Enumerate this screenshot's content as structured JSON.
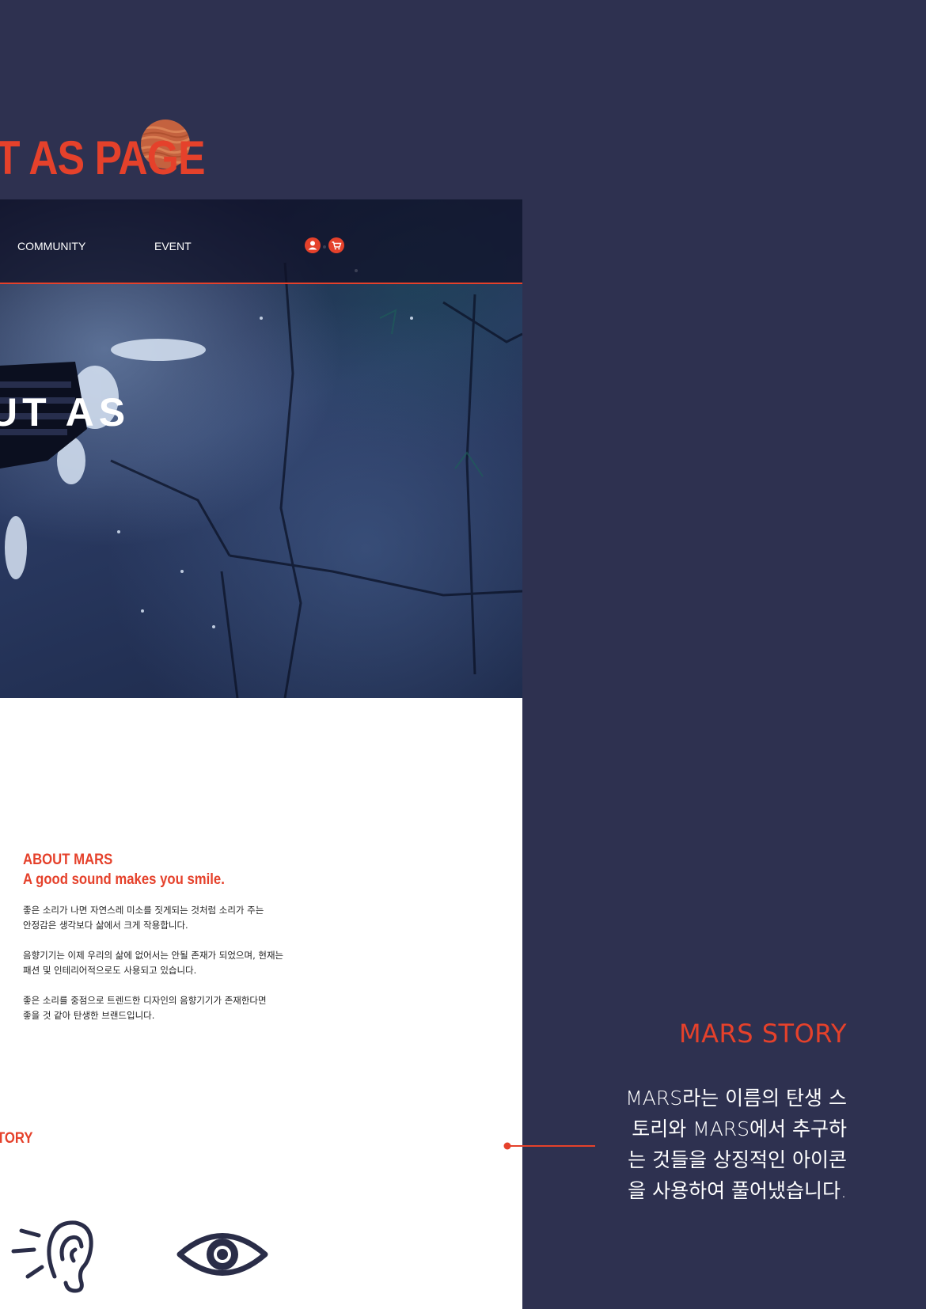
{
  "page": {
    "title": "T AS PAGE"
  },
  "nav": {
    "items": [
      {
        "label": "COMMUNITY"
      },
      {
        "label": "EVENT"
      }
    ],
    "icons": [
      "user-icon",
      "cart-icon"
    ]
  },
  "hero": {
    "text": "UT AS"
  },
  "about": {
    "heading": "ABOUT MARS",
    "subheading": "A good sound makes you smile.",
    "paragraphs": [
      {
        "line1": "좋은 소리가 나면 자연스레 미소를 짓게되는 것처럼 소리가 주는",
        "line2": "안정감은 생각보다 삶에서 크게 작용합니다."
      },
      {
        "line1": "음향기기는 이제 우리의 삶에 없어서는 안될 존재가 되었으며, 현재는",
        "line2": "패션 및 인테리어적으로도 사용되고 있습니다."
      },
      {
        "line1": "좋은 소리를 중점으로 트렌드한 디자인의 음향기기가 존재한다면",
        "line2": "좋을 것 같아 탄생한 브랜드입니다."
      }
    ],
    "story_tag": "TORY",
    "icons": [
      "ear-icon",
      "eye-icon"
    ]
  },
  "story": {
    "title": "MARS STORY",
    "lines": [
      "MARS라는 이름의 탄생 스",
      "토리와 MARS에서 추구하",
      "는 것들을 상징적인 아이콘",
      "을 사용하여 풀어냈습니다."
    ]
  },
  "colors": {
    "background": "#2e3150",
    "accent": "#e5412b",
    "panel": "#ffffff",
    "icon_stroke": "#2a2d48"
  }
}
